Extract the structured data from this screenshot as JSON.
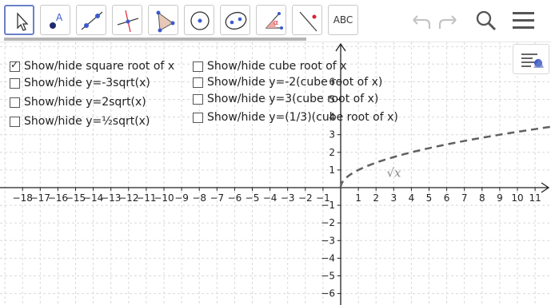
{
  "toolbar": {
    "tools": [
      {
        "name": "move-tool",
        "label": ""
      },
      {
        "name": "point-tool",
        "label": "A"
      },
      {
        "name": "line-tool",
        "label": ""
      },
      {
        "name": "perpendicular-line-tool",
        "label": ""
      },
      {
        "name": "polygon-tool",
        "label": ""
      },
      {
        "name": "circle-tool",
        "label": ""
      },
      {
        "name": "ellipse-tool",
        "label": ""
      },
      {
        "name": "angle-tool",
        "label": "α"
      },
      {
        "name": "reflect-tool",
        "label": ""
      },
      {
        "name": "text-tool",
        "label": "ABC"
      }
    ],
    "undo_icon": "undo-icon",
    "redo_icon": "redo-icon",
    "search_icon": "search-icon",
    "menu_icon": "menu-icon"
  },
  "checkboxes": [
    {
      "id": "sqrt",
      "label": "Show/hide square root of x",
      "checked": true
    },
    {
      "id": "neg3sqrt",
      "label": "Show/hide y=-3sqrt(x)",
      "checked": false
    },
    {
      "id": "2sqrt",
      "label": "Show/hide y=2sqrt(x)",
      "checked": false
    },
    {
      "id": "halfsqrt",
      "label": "Show/hide y=½sqrt(x)",
      "checked": false
    },
    {
      "id": "cbrt",
      "label": "Show/hide cube root of x",
      "checked": false
    },
    {
      "id": "neg2cbrt",
      "label": "Show/hide y=-2(cube root of x)",
      "checked": false
    },
    {
      "id": "3cbrt",
      "label": "Show/hide y=3(cube root of x)",
      "checked": false
    },
    {
      "id": "thirdcbrt",
      "label": "Show/hide y=(1/3)(cube root of x)",
      "checked": false
    }
  ],
  "graph": {
    "x_ticks": [
      -18,
      -17,
      -16,
      -15,
      -14,
      -13,
      -12,
      -11,
      -10,
      -9,
      -8,
      -7,
      -6,
      -5,
      -4,
      -3,
      -2,
      -1,
      1,
      2,
      3,
      4,
      5,
      6,
      7,
      8,
      9,
      10,
      11
    ],
    "y_ticks": [
      -6,
      -5,
      -4,
      -3,
      -2,
      -1,
      1,
      2,
      3,
      4,
      5,
      6
    ],
    "x_range": [
      -19,
      11.6
    ],
    "y_range": [
      -6.3,
      10
    ],
    "curve_label": "√x",
    "curve_color": "#606060",
    "grid_color": "#d9d9d9"
  },
  "chart_data": {
    "type": "line",
    "series": [
      {
        "name": "√x",
        "function": "sqrt(x)",
        "x": [
          0,
          1,
          4,
          9,
          11.6
        ],
        "y": [
          0,
          1,
          2,
          3,
          3.41
        ]
      }
    ],
    "xlim": [
      -19,
      11.6
    ],
    "ylim": [
      -6.3,
      10
    ],
    "grid": true,
    "title": "",
    "xlabel": "",
    "ylabel": ""
  }
}
